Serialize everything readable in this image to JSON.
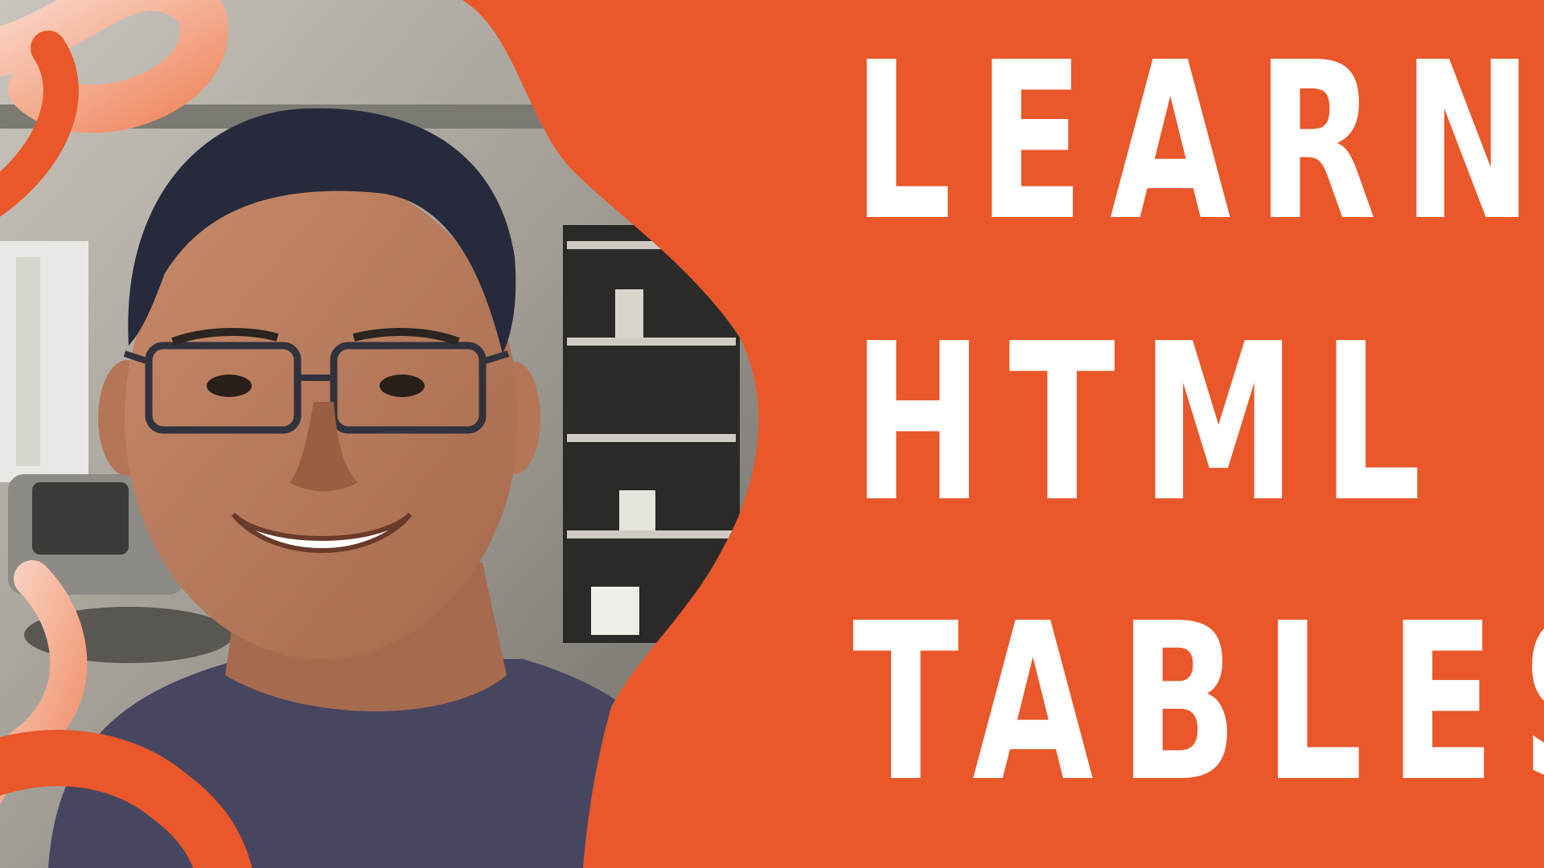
{
  "headline": {
    "line1": "LEARN",
    "line2": "HTML",
    "line3": "TABLES"
  },
  "colors": {
    "background_orange": "#e9572a",
    "accent_light": "#f7c1a9",
    "text": "#ffffff",
    "shirt": "#474661",
    "room_gray": "#9d9a94"
  },
  "icons": [
    "decorative-swirl",
    "presenter-photo"
  ]
}
